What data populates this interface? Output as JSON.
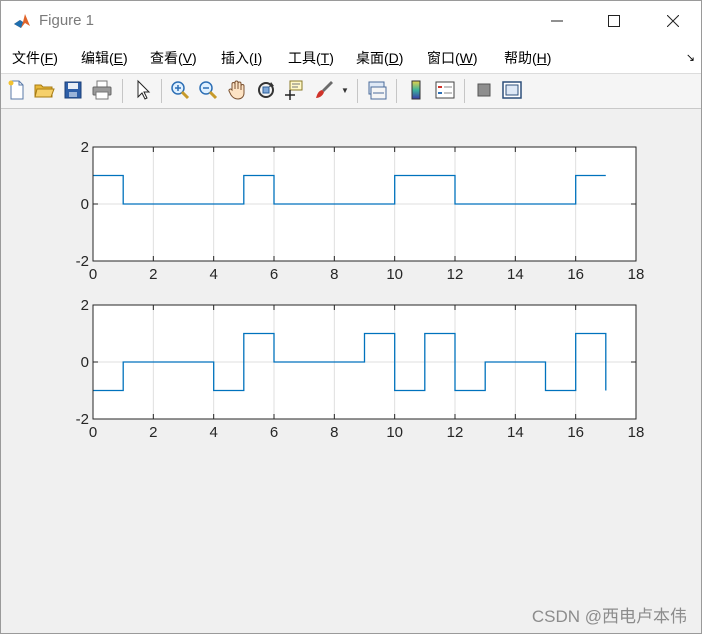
{
  "window": {
    "title": "Figure 1",
    "controls": {
      "minimize": "—",
      "maximize": "☐",
      "close": "✕"
    }
  },
  "menu": {
    "items": [
      {
        "label": "文件(",
        "key": "F",
        "suffix": ")"
      },
      {
        "label": "编辑(",
        "key": "E",
        "suffix": ")"
      },
      {
        "label": "查看(",
        "key": "V",
        "suffix": ")"
      },
      {
        "label": "插入(",
        "key": "I",
        "suffix": ")"
      },
      {
        "label": "工具(",
        "key": "T",
        "suffix": ")"
      },
      {
        "label": "桌面(",
        "key": "D",
        "suffix": ")"
      },
      {
        "label": "窗口(",
        "key": "W",
        "suffix": ")"
      },
      {
        "label": "帮助(",
        "key": "H",
        "suffix": ")"
      }
    ],
    "overflow_arrow": "↘"
  },
  "toolbar": {
    "icons": [
      "new-figure-icon",
      "open-file-icon",
      "save-icon",
      "print-icon",
      "pointer-icon",
      "zoom-in-icon",
      "zoom-out-icon",
      "pan-hand-icon",
      "rotate-3d-icon",
      "data-cursor-icon",
      "brush-icon",
      "brush-dropdown-icon",
      "link-plot-icon",
      "colorbar-icon",
      "legend-icon",
      "hide-plot-tools-icon",
      "show-plot-tools-icon"
    ]
  },
  "colors": {
    "line": "#0072bd",
    "axes": "#262626",
    "grid": "#dfdfdf"
  },
  "chart_data": [
    {
      "type": "line",
      "step": true,
      "x": [
        0,
        1,
        1,
        5,
        5,
        6,
        6,
        10,
        10,
        12,
        12,
        16,
        16,
        17
      ],
      "y": [
        1,
        1,
        0,
        0,
        1,
        1,
        0,
        0,
        1,
        1,
        0,
        0,
        1,
        1
      ],
      "xlim": [
        0,
        18
      ],
      "ylim": [
        -2,
        2
      ],
      "xticks": [
        "0",
        "2",
        "4",
        "6",
        "8",
        "10",
        "12",
        "14",
        "16",
        "18"
      ],
      "yticks": [
        "2",
        "0",
        "-2"
      ],
      "grid": true
    },
    {
      "type": "line",
      "step": true,
      "x": [
        0,
        1,
        1,
        4,
        4,
        5,
        5,
        6,
        6,
        9,
        9,
        10,
        10,
        11,
        11,
        12,
        12,
        13,
        13,
        15,
        15,
        16,
        16,
        17,
        17
      ],
      "y": [
        -1,
        -1,
        0,
        0,
        -1,
        -1,
        1,
        1,
        0,
        0,
        1,
        1,
        -1,
        -1,
        1,
        1,
        -1,
        -1,
        0,
        0,
        -1,
        -1,
        1,
        1,
        -1
      ],
      "xlim": [
        0,
        18
      ],
      "ylim": [
        -2,
        2
      ],
      "xticks": [
        "0",
        "2",
        "4",
        "6",
        "8",
        "10",
        "12",
        "14",
        "16",
        "18"
      ],
      "yticks": [
        "2",
        "0",
        "-2"
      ],
      "grid": true
    }
  ],
  "watermark": "CSDN @西电卢本伟"
}
